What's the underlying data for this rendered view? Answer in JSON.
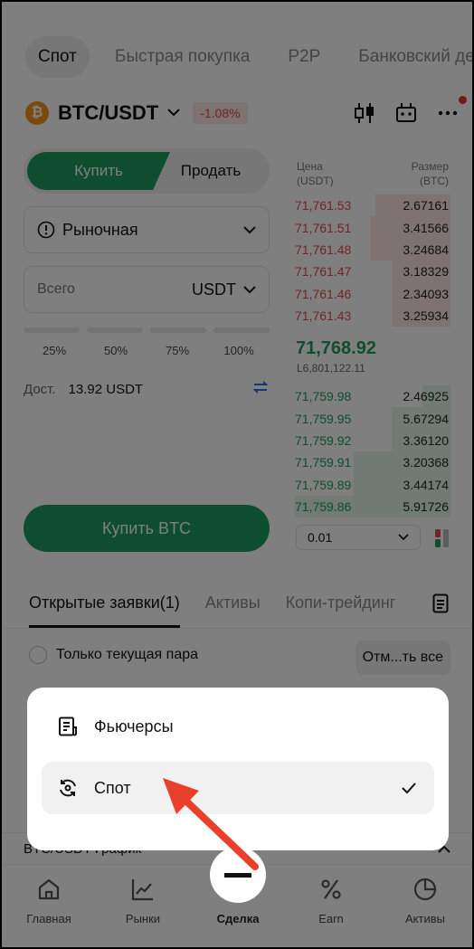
{
  "top_tabs": [
    "Спот",
    "Быстрая покупка",
    "P2P",
    "Банковский деп"
  ],
  "pair": {
    "coin_logo": "₿",
    "name": "BTC/USDT",
    "change": "-1.08%"
  },
  "trade": {
    "buy_label": "Купить",
    "sell_label": "Продать",
    "order_type": "Рыночная",
    "total_placeholder": "Всего",
    "total_unit": "USDT",
    "percent_levels": [
      "25%",
      "50%",
      "75%",
      "100%"
    ],
    "available_label": "Дост.",
    "available_value": "13.92 USDT",
    "buy_button": "Купить BTC"
  },
  "order_book": {
    "price_header": "Цена\n(USDT)",
    "price_header_l1": "Цена",
    "price_header_l2": "(USDT)",
    "size_header_l1": "Размер",
    "size_header_l2": "(BTC)",
    "asks": [
      {
        "price": "71,761.53",
        "size": "2.67161",
        "depth": 0.48
      },
      {
        "price": "71,761.51",
        "size": "3.41566",
        "depth": 0.52
      },
      {
        "price": "71,761.48",
        "size": "3.24684",
        "depth": 0.52
      },
      {
        "price": "71,761.47",
        "size": "3.18329",
        "depth": 0.38
      },
      {
        "price": "71,761.46",
        "size": "2.34093",
        "depth": 0.38
      },
      {
        "price": "71,761.43",
        "size": "3.25934",
        "depth": 0.38
      }
    ],
    "last_price": "71,768.92",
    "mark_price": "L6,801,122.11",
    "bids": [
      {
        "price": "71,759.98",
        "size": "2.46925",
        "depth": 0.18
      },
      {
        "price": "71,759.95",
        "size": "5.67294",
        "depth": 0.38
      },
      {
        "price": "71,759.92",
        "size": "3.36120",
        "depth": 0.38
      },
      {
        "price": "71,759.91",
        "size": "3.20368",
        "depth": 0.62
      },
      {
        "price": "71,759.89",
        "size": "3.44174",
        "depth": 0.62
      },
      {
        "price": "71,759.86",
        "size": "5.91726",
        "depth": 1.0
      }
    ],
    "precision": "0.01"
  },
  "orders": {
    "tabs": [
      "Открытые заявки(1)",
      "Активы",
      "Копи-трейдинг"
    ],
    "only_current_pair": "Только текущая пара",
    "cancel_all": "Отм...ть все"
  },
  "chart_bar": {
    "label": "BTC/USDT График"
  },
  "popup": {
    "items": [
      {
        "label": "Фьючерсы",
        "icon": "futures-doc-icon",
        "selected": false
      },
      {
        "label": "Спот",
        "icon": "spot-exchange-icon",
        "selected": true
      }
    ]
  },
  "bottom_nav": [
    {
      "label": "Главная",
      "icon": "home-icon"
    },
    {
      "label": "Рынки",
      "icon": "markets-chart-icon"
    },
    {
      "label": "Сделка",
      "icon": "trade-icon"
    },
    {
      "label": "Earn",
      "icon": "percent-icon"
    },
    {
      "label": "Активы",
      "icon": "pie-chart-icon"
    }
  ],
  "colors": {
    "accent_green": "#1e9a5f",
    "ask_red": "#e04a4a",
    "annotation_arrow": "#e8402a"
  }
}
